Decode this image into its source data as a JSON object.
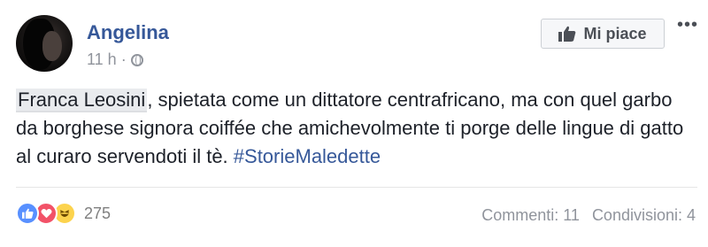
{
  "post": {
    "author": "Angelina",
    "time": "11 h",
    "separator": "·",
    "privacy_icon": "globe-icon",
    "like_button_label": "Mi piace",
    "more_icon": "•••",
    "text": {
      "tagged_name": "Franca Leosini",
      "line_body": ", spietata come un dittatore centrafricano, ma con quel garbo da borghese signora coiffée che amichevolmente ti porge delle lingue di gatto al curaro servendoti il tè. ",
      "hashtag": "#StorieMaledette"
    }
  },
  "footer": {
    "reaction_icons": [
      "like-icon",
      "love-icon",
      "haha-icon"
    ],
    "reaction_count": "275",
    "comments": "Commenti: 11",
    "shares": "Condivisioni: 4"
  },
  "colors": {
    "link_blue": "#365899",
    "meta_gray": "#90949c",
    "like_blue": "#5890ff",
    "love_red": "#f25268",
    "haha_yellow": "#fcd34d"
  }
}
